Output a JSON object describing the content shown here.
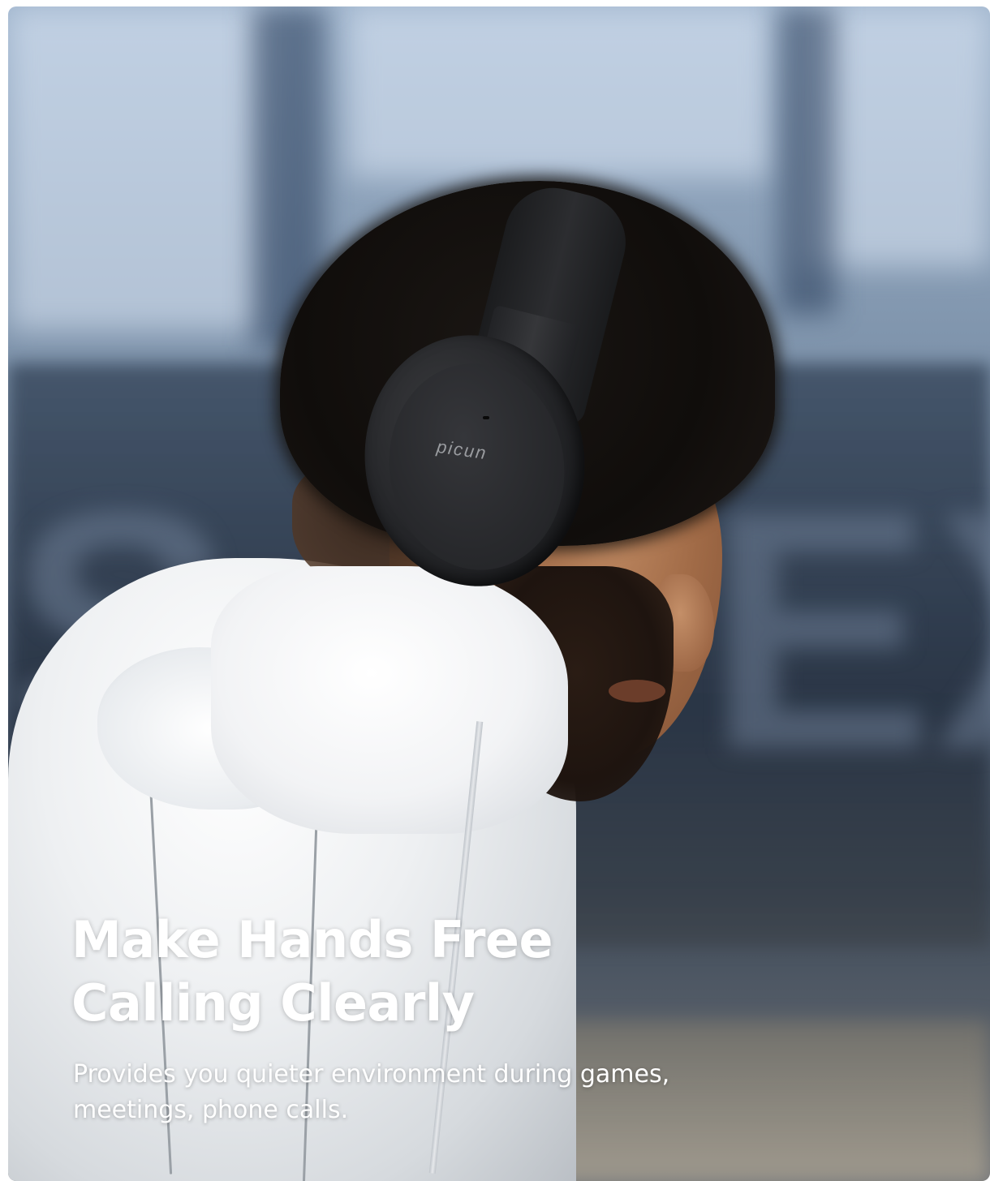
{
  "hero": {
    "headline_line1": "Make Hands Free",
    "headline_line2": "Calling Clearly",
    "subline_line1": "Provides you quieter environment during games,",
    "subline_line2": "meetings, phone calls."
  },
  "product": {
    "brand_logo": "picun"
  }
}
